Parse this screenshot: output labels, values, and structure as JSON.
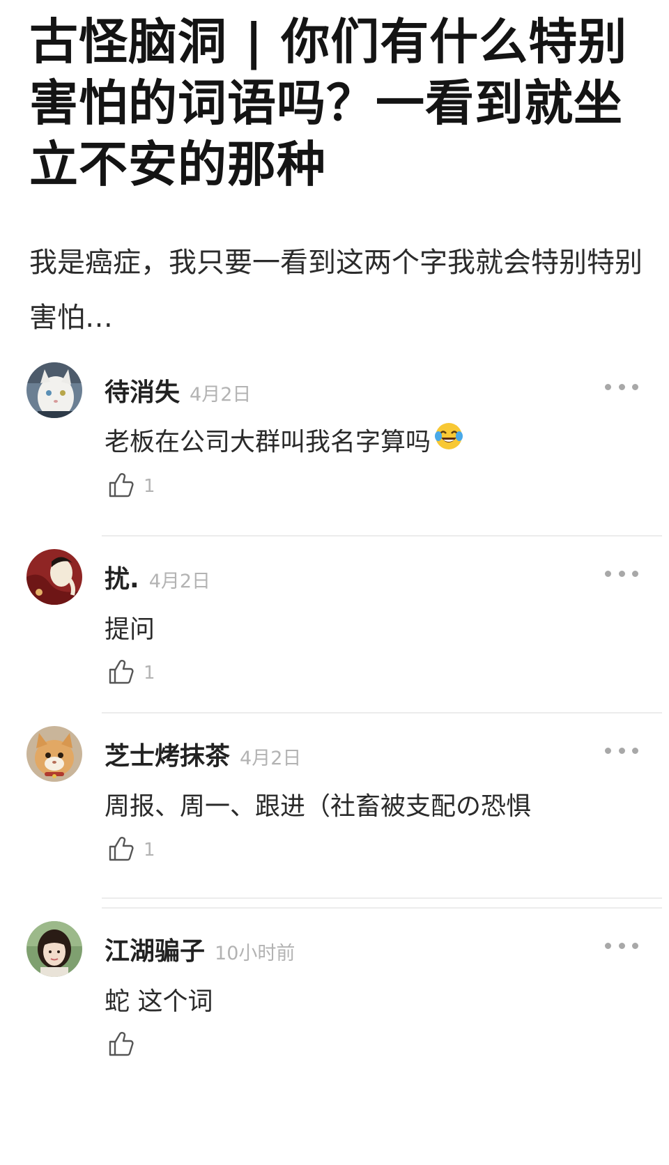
{
  "post": {
    "title": "古怪脑洞 | 你们有什么特别害怕的词语吗？一看到就坐立不安的那种",
    "body": "我是癌症，我只要一看到这两个字我就会特别特别害怕…"
  },
  "comments": [
    {
      "username": "待消失",
      "time": "4月2日",
      "text": "老板在公司大群叫我名字算吗",
      "emoji": "laughing-tears-emoji",
      "likes": "1",
      "avatar": "white-cat-avatar"
    },
    {
      "username": "扰.",
      "time": "4月2日",
      "text": "提问",
      "likes": "1",
      "avatar": "red-illustration-avatar"
    },
    {
      "username": "芝士烤抹茶",
      "time": "4月2日",
      "text": "周报、周一、跟进（社畜被支配の恐惧",
      "likes": "1",
      "avatar": "orange-cat-avatar"
    },
    {
      "username": "江湖骗子",
      "time": "10小时前",
      "text": "蛇 这个词",
      "likes": "",
      "avatar": "girl-photo-avatar"
    }
  ],
  "icons": {
    "like": "thumbs-up-icon",
    "more": "more-dots-icon"
  },
  "colors": {
    "text": "#1a1a1a",
    "muted": "#b3b3b3",
    "divider": "#ececec"
  }
}
